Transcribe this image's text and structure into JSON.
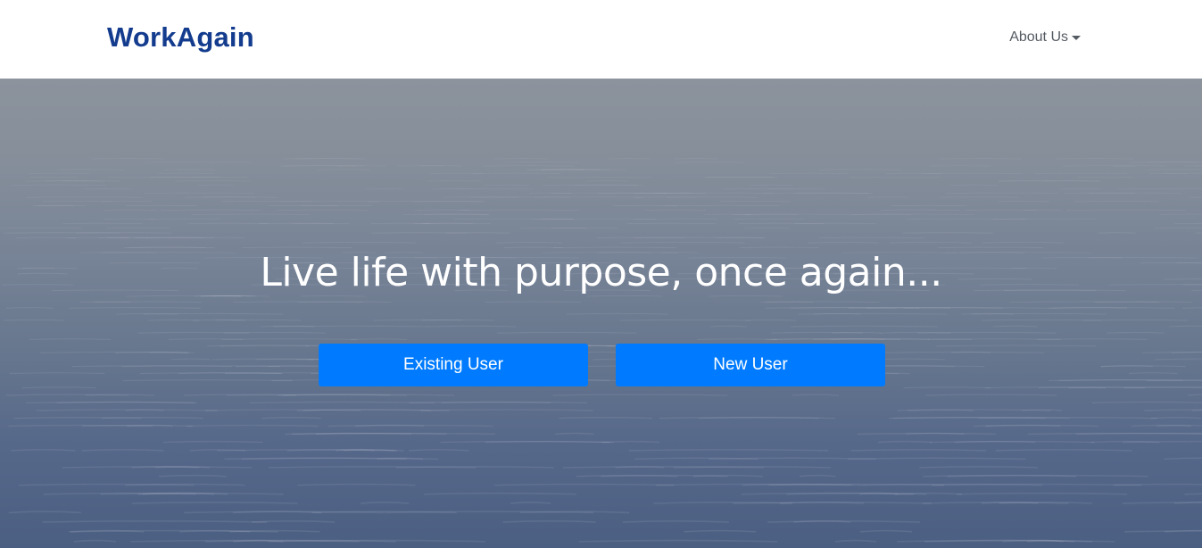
{
  "navbar": {
    "brand": "WorkAgain",
    "brand_color": "#143c8e",
    "menu": {
      "label": "About Us",
      "icon": "caret-down-icon"
    }
  },
  "hero": {
    "background": "calm-sea-photo",
    "headline": "Live life with purpose, once again...",
    "buttons": {
      "existing_user": "Existing User",
      "new_user": "New User"
    },
    "button_color": "#007bff"
  }
}
